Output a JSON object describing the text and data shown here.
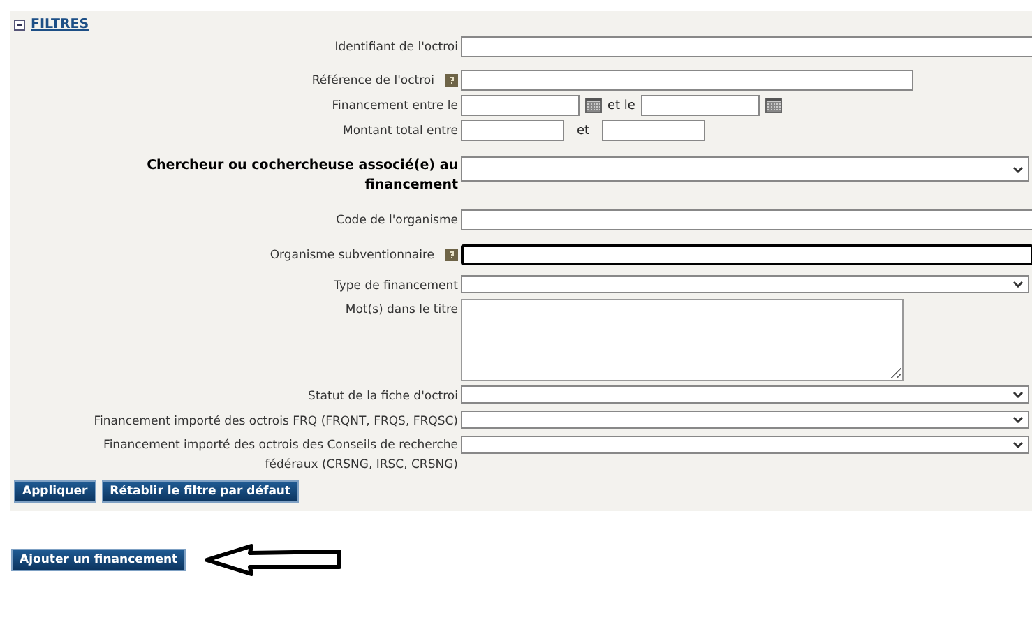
{
  "filters": {
    "title": "FILTRES",
    "expanded": true,
    "fields": [
      {
        "kind": "text",
        "label": "Identifiant de l'octroi",
        "bold": false,
        "help": false,
        "focused": false
      },
      {
        "kind": "short_text",
        "label": "Référence de l'octroi",
        "bold": false,
        "help": true,
        "focused": false
      },
      {
        "kind": "date_range",
        "label": "Financement entre le",
        "between": "et le"
      },
      {
        "kind": "amount_range",
        "label": "Montant total entre",
        "between": "et"
      },
      {
        "kind": "select",
        "label": "Chercheur ou cochercheuse associé(e) au financement",
        "bold": true,
        "tall": true
      },
      {
        "kind": "text",
        "label": "Code de l'organisme",
        "bold": false,
        "help": false,
        "focused": false
      },
      {
        "kind": "text",
        "label": "Organisme subventionnaire",
        "bold": false,
        "help": true,
        "focused": true
      },
      {
        "kind": "select",
        "label": "Type de financement",
        "bold": false,
        "tall": false
      },
      {
        "kind": "textarea",
        "label": "Mot(s) dans le titre"
      },
      {
        "kind": "select",
        "label": "Statut de la fiche d'octroi",
        "bold": false,
        "tall": false
      },
      {
        "kind": "select",
        "label": "Financement importé des octrois FRQ (FRQNT, FRQS, FRQSC)",
        "bold": false,
        "tall": false
      },
      {
        "kind": "select",
        "label": "Financement importé des octrois des Conseils de recherche fédéraux (CRSNG, IRSC, CRSNG)",
        "bold": false,
        "tall": false
      }
    ],
    "buttons": [
      "Appliquer",
      "Rétablir le filtre par défaut"
    ]
  },
  "add_button": "Ajouter un financement"
}
